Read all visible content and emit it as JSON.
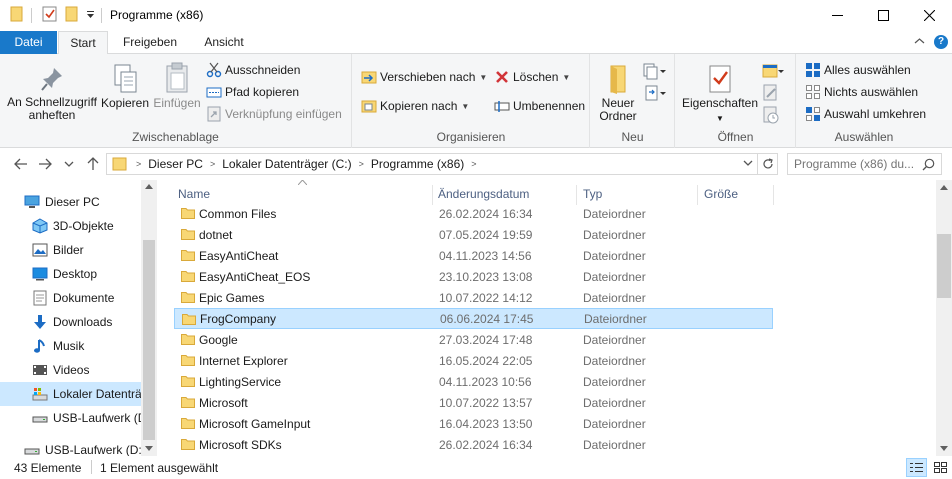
{
  "window": {
    "title": "Programme (x86)"
  },
  "tabs": [
    {
      "label": "Datei"
    },
    {
      "label": "Start"
    },
    {
      "label": "Freigeben"
    },
    {
      "label": "Ansicht"
    }
  ],
  "ribbon": {
    "clipboard": {
      "group_label": "Zwischenablage",
      "pin_label_1": "An Schnellzugriff",
      "pin_label_2": "anheften",
      "copy_label": "Kopieren",
      "paste_label": "Einfügen",
      "cut_label": "Ausschneiden",
      "copy_path_label": "Pfad kopieren",
      "paste_shortcut_label": "Verknüpfung einfügen"
    },
    "organize": {
      "group_label": "Organisieren",
      "move_to_label": "Verschieben nach",
      "copy_to_label": "Kopieren nach",
      "delete_label": "Löschen",
      "rename_label": "Umbenennen"
    },
    "new": {
      "group_label": "Neu",
      "new_folder_label_1": "Neuer",
      "new_folder_label_2": "Ordner"
    },
    "open": {
      "group_label": "Öffnen",
      "properties_label": "Eigenschaften"
    },
    "select": {
      "group_label": "Auswählen",
      "select_all_label": "Alles auswählen",
      "select_none_label": "Nichts auswählen",
      "invert_label": "Auswahl umkehren"
    }
  },
  "address": {
    "crumbs": [
      "Dieser PC",
      "Lokaler Datenträger (C:)",
      "Programme (x86)"
    ],
    "search_placeholder": "Programme (x86) du..."
  },
  "navpane": {
    "items": [
      {
        "label": "Dieser PC",
        "icon": "computer-icon"
      },
      {
        "label": "3D-Objekte",
        "icon": "3d-objects-icon"
      },
      {
        "label": "Bilder",
        "icon": "pictures-icon"
      },
      {
        "label": "Desktop",
        "icon": "desktop-icon"
      },
      {
        "label": "Dokumente",
        "icon": "documents-icon"
      },
      {
        "label": "Downloads",
        "icon": "downloads-icon"
      },
      {
        "label": "Musik",
        "icon": "music-icon"
      },
      {
        "label": "Videos",
        "icon": "videos-icon"
      },
      {
        "label": "Lokaler Datenträ",
        "icon": "drive-icon"
      },
      {
        "label": "USB-Laufwerk (D",
        "icon": "usb-drive-icon"
      },
      {
        "label": "USB-Laufwerk (D:)",
        "icon": "usb-drive-icon"
      }
    ]
  },
  "filelist": {
    "columns": {
      "name": "Name",
      "date": "Änderungsdatum",
      "type": "Typ",
      "size": "Größe"
    },
    "rows": [
      {
        "name": "Common Files",
        "date": "26.02.2024 16:34",
        "type": "Dateiordner"
      },
      {
        "name": "dotnet",
        "date": "07.05.2024 19:59",
        "type": "Dateiordner"
      },
      {
        "name": "EasyAntiCheat",
        "date": "04.11.2023 14:56",
        "type": "Dateiordner"
      },
      {
        "name": "EasyAntiCheat_EOS",
        "date": "23.10.2023 13:08",
        "type": "Dateiordner"
      },
      {
        "name": "Epic Games",
        "date": "10.07.2022 14:12",
        "type": "Dateiordner"
      },
      {
        "name": "FrogCompany",
        "date": "06.06.2024 17:45",
        "type": "Dateiordner",
        "selected": true
      },
      {
        "name": "Google",
        "date": "27.03.2024 17:48",
        "type": "Dateiordner"
      },
      {
        "name": "Internet Explorer",
        "date": "16.05.2024 22:05",
        "type": "Dateiordner"
      },
      {
        "name": "LightingService",
        "date": "04.11.2023 10:56",
        "type": "Dateiordner"
      },
      {
        "name": "Microsoft",
        "date": "10.07.2022 13:57",
        "type": "Dateiordner"
      },
      {
        "name": "Microsoft GameInput",
        "date": "16.04.2023 13:50",
        "type": "Dateiordner"
      },
      {
        "name": "Microsoft SDKs",
        "date": "26.02.2024 16:34",
        "type": "Dateiordner"
      }
    ]
  },
  "status": {
    "count": "43 Elemente",
    "selection": "1 Element ausgewählt"
  },
  "colors": {
    "accent": "#1979ca",
    "selection": "#cce8ff",
    "folder": "#f8d775"
  }
}
